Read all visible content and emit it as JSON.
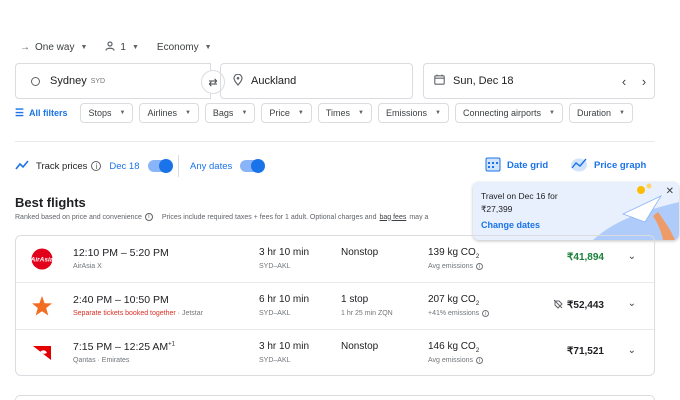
{
  "trip": {
    "type_label": "One way",
    "passengers": "1",
    "cabin": "Economy"
  },
  "search": {
    "from_city": "Sydney",
    "from_code": "SYD",
    "to_city": "Auckland",
    "date": "Sun, Dec 18"
  },
  "filters": {
    "all_filters": "All filters",
    "chips": [
      "Stops",
      "Airlines",
      "Bags",
      "Price",
      "Times",
      "Emissions",
      "Connecting airports",
      "Duration"
    ]
  },
  "tracking": {
    "track_label": "Track prices",
    "track_date": "Dec 18",
    "any_dates": "Any dates",
    "date_grid": "Date grid",
    "price_graph": "Price graph"
  },
  "popup": {
    "line1": "Travel on Dec 16 for",
    "line2": "₹27,399",
    "link": "Change dates"
  },
  "best": {
    "title": "Best flights",
    "subtitle_a": "Ranked based on price and convenience",
    "subtitle_b": "Prices include required taxes + fees for 1 adult. Optional charges and",
    "bag_fees": "bag fees",
    "subtitle_c": "may a"
  },
  "flights": [
    {
      "time": "12:10 PM – 5:20 PM",
      "time_sup": "",
      "airline": "AirAsia X",
      "warning": "",
      "duration": "3 hr 10 min",
      "route": "SYD–AKL",
      "stops": "Nonstop",
      "stop_detail": "",
      "co2": "139 kg CO",
      "emissions": "Avg emissions",
      "price": "₹41,894",
      "price_color": "#188038"
    },
    {
      "time": "2:40 PM – 10:50 PM",
      "time_sup": "",
      "airline": "Jetstar",
      "warning": "Separate tickets booked together",
      "duration": "6 hr 10 min",
      "route": "SYD–AKL",
      "stops": "1 stop",
      "stop_detail": "1 hr 25 min ZQN",
      "co2": "207 kg CO",
      "emissions": "+41% emissions",
      "price": "₹52,443",
      "price_color": "#202124"
    },
    {
      "time": "7:15 PM – 12:25 AM",
      "time_sup": "+1",
      "airline": "Qantas · Emirates",
      "warning": "",
      "duration": "3 hr 10 min",
      "route": "SYD–AKL",
      "stops": "Nonstop",
      "stop_detail": "",
      "co2": "146 kg CO",
      "emissions": "Avg emissions",
      "price": "₹71,521",
      "price_color": "#202124"
    }
  ],
  "colors": {
    "accent": "#1a73e8",
    "price_green": "#188038",
    "warning_red": "#d93025"
  }
}
